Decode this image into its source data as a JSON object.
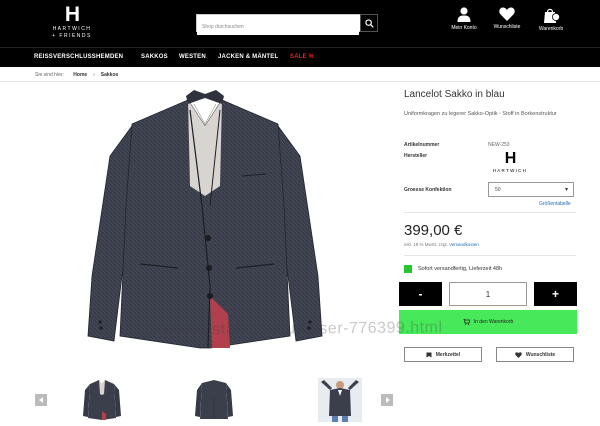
{
  "header": {
    "logo_letter": "H",
    "logo_text": "HARTWICH",
    "logo_sub": "+ FRIENDS",
    "search_placeholder": "Shop durchsuchen",
    "account_label": "Mein Konto",
    "wishlist_label": "Wunschliste",
    "cart_label": "Warenkorb",
    "cart_count": "0"
  },
  "nav": {
    "items": [
      "REISSVERSCHLUSSHEMDEN",
      "SAKKOS",
      "WESTEN",
      "JACKEN & MÄNTEL",
      "SALE %"
    ]
  },
  "breadcrumb": {
    "prefix": "Sie sind hier:",
    "home": "Home",
    "current": "Sakkos"
  },
  "product": {
    "title": "Lancelot Sakko in blau",
    "description": "Uniformkragen zu legerer Sakko-Optik - Stoff in Borkenstruktur",
    "sku_label": "Artikelnummer",
    "sku_value": "NEW-253",
    "maker_label": "Hersteller",
    "maker_logo_letter": "H",
    "maker_logo_text": "HARTWICH",
    "size_label": "Groesse Konfektion",
    "size_value": "50",
    "size_table": "Größentabelle",
    "price": "399,00 €",
    "vat_text": "inkl. 19 % MwSt. zzgl.",
    "shipping_link": "Versandkosten",
    "stock_text": "Sofort versandfertig, Lieferzeit 48h",
    "qty_minus": "-",
    "qty_value": "1",
    "qty_plus": "+",
    "add_to_cart": "In den Warenkorb",
    "note_button": "Merkzettel",
    "wish_button": "Wunschliste"
  },
  "watermark": "www.kidstaff.com.ua/user-776399.html",
  "colors": {
    "header_bg": "#000000",
    "sale": "#e22222",
    "cart_green": "#47e859",
    "stock_green": "#29c52e",
    "link_blue": "#1f6db4",
    "jacket": "#3b3f4c"
  }
}
